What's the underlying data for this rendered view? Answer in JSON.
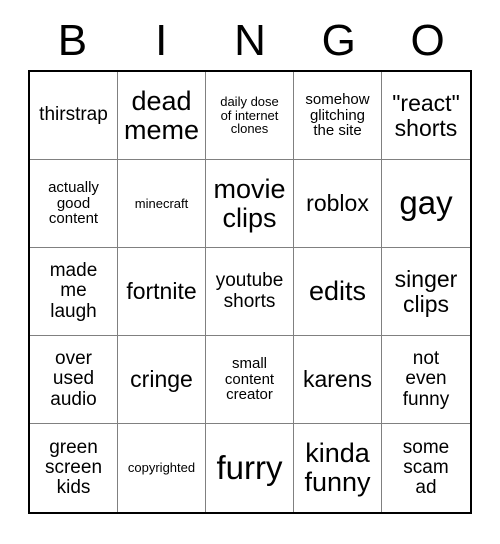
{
  "header": {
    "letters": [
      "B",
      "I",
      "N",
      "G",
      "O"
    ]
  },
  "grid": {
    "rows": 5,
    "columns": 5,
    "border_color": "#000000",
    "gridline_color": "#808080",
    "background_color": "#ffffff",
    "text_color": "#000000",
    "cells": [
      {
        "text": "thirstrap",
        "size": "m"
      },
      {
        "text": "dead\nmeme",
        "size": "xl"
      },
      {
        "text": "daily dose\nof internet\nclones",
        "size": "xs"
      },
      {
        "text": "somehow\nglitching\nthe site",
        "size": "s"
      },
      {
        "text": "\"react\"\nshorts",
        "size": "l"
      },
      {
        "text": "actually\ngood\ncontent",
        "size": "s"
      },
      {
        "text": "minecraft",
        "size": "xs"
      },
      {
        "text": "movie\nclips",
        "size": "xl"
      },
      {
        "text": "roblox",
        "size": "l"
      },
      {
        "text": "gay",
        "size": "xxl"
      },
      {
        "text": "made\nme\nlaugh",
        "size": "m"
      },
      {
        "text": "fortnite",
        "size": "l"
      },
      {
        "text": "youtube\nshorts",
        "size": "m"
      },
      {
        "text": "edits",
        "size": "xl"
      },
      {
        "text": "singer\nclips",
        "size": "l"
      },
      {
        "text": "over\nused\naudio",
        "size": "m"
      },
      {
        "text": "cringe",
        "size": "l"
      },
      {
        "text": "small\ncontent\ncreator",
        "size": "s"
      },
      {
        "text": "karens",
        "size": "l"
      },
      {
        "text": "not\neven\nfunny",
        "size": "m"
      },
      {
        "text": "green\nscreen\nkids",
        "size": "m"
      },
      {
        "text": "copyrighted",
        "size": "xs"
      },
      {
        "text": "furry",
        "size": "xxl"
      },
      {
        "text": "kinda\nfunny",
        "size": "xl"
      },
      {
        "text": "some\nscam\nad",
        "size": "m"
      }
    ]
  }
}
